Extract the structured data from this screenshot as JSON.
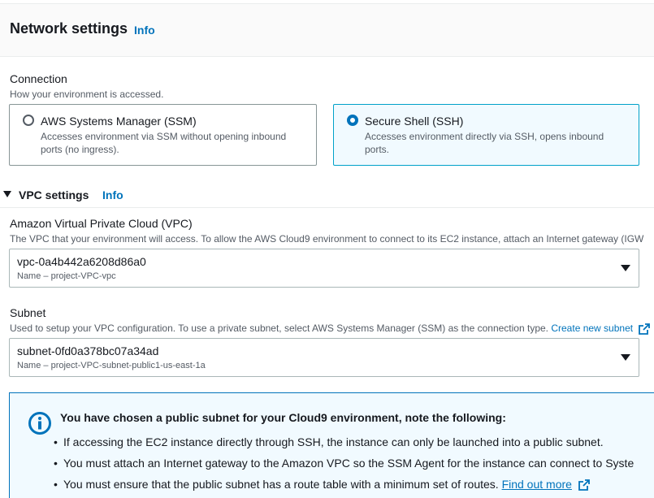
{
  "header": {
    "title": "Network settings",
    "info": "Info"
  },
  "connection": {
    "label": "Connection",
    "description": "How your environment is accessed.",
    "options": [
      {
        "title": "AWS Systems Manager (SSM)",
        "description": "Accesses environment via SSM without opening inbound ports (no ingress).",
        "selected": false
      },
      {
        "title": "Secure Shell (SSH)",
        "description": "Accesses environment directly via SSH, opens inbound ports.",
        "selected": true
      }
    ]
  },
  "vpc_settings": {
    "title": "VPC settings",
    "info": "Info",
    "expanded": true,
    "vpc": {
      "label": "Amazon Virtual Private Cloud (VPC)",
      "description": "The VPC that your environment will access. To allow the AWS Cloud9 environment to connect to its EC2 instance, attach an Internet gateway (IGW",
      "value": "vpc-0a4b442a6208d86a0",
      "sub": "Name – project-VPC-vpc"
    },
    "subnet": {
      "label": "Subnet",
      "description": "Used to setup your VPC configuration. To use a private subnet, select AWS Systems Manager (SSM) as the connection type.",
      "link": "Create new subnet",
      "value": "subnet-0fd0a378bc07a34ad",
      "sub": "Name – project-VPC-subnet-public1-us-east-1a"
    }
  },
  "alert": {
    "title_pre": "You have chosen a ",
    "title_bold": "public",
    "title_post": " subnet for your Cloud9 environment, note the following:",
    "bullets": [
      "If accessing the EC2 instance directly through SSH, the instance can only be launched into a public subnet.",
      "You must attach an Internet gateway to the Amazon VPC so the SSM Agent for the instance can connect to Syste",
      "You must ensure that the public subnet has a route table with a minimum set of routes."
    ],
    "link": "Find out more"
  },
  "colors": {
    "accent": "#0073bb",
    "selected_border": "#00a1c9",
    "selected_bg": "#f1faff"
  }
}
